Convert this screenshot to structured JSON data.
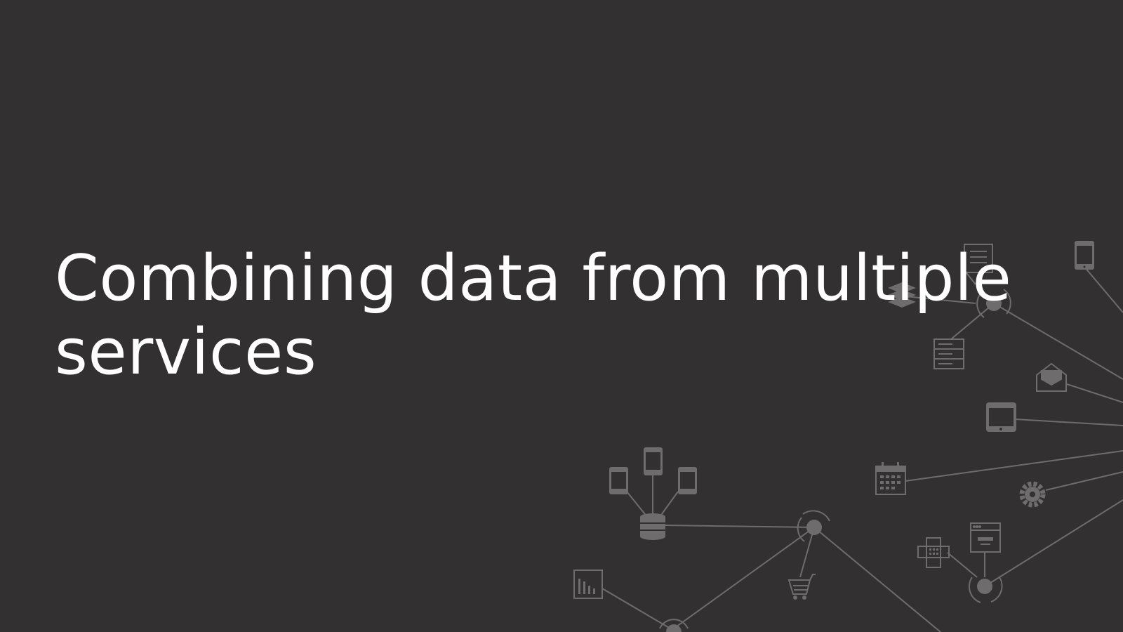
{
  "slide": {
    "title": "Combining data from multiple\nservices"
  },
  "colors": {
    "background": "#323031",
    "title": "#ffffff",
    "network": "#6e6c6d"
  },
  "network_icons": [
    "document-icon",
    "phone-icon",
    "layers-icon",
    "server-icon",
    "mail-icon",
    "tablet-icon",
    "calendar-icon",
    "gear-icon",
    "browser-window-icon",
    "fax-icon",
    "phone-icon",
    "database-icon",
    "shopping-cart-icon",
    "bar-chart-icon"
  ]
}
